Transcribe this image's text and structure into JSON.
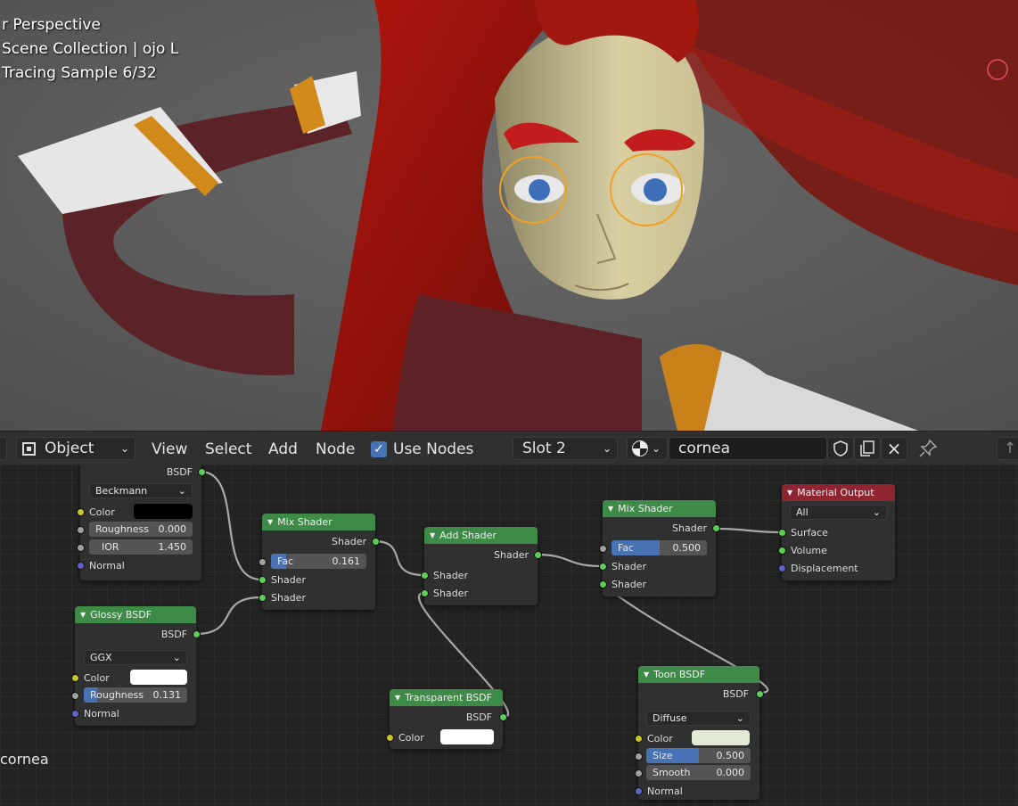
{
  "viewport": {
    "lines": [
      "r Perspective",
      "Scene Collection | ojo L",
      "Tracing Sample 6/32"
    ]
  },
  "header": {
    "mode": "Object",
    "menus": [
      "View",
      "Select",
      "Add",
      "Node"
    ],
    "use_nodes_label": "Use Nodes",
    "use_nodes_checked": true,
    "slot": "Slot 2",
    "material_name": "cornea"
  },
  "editor": {
    "material_label": "cornea",
    "nodes": {
      "glass": {
        "output": "BSDF",
        "distribution": "Beckmann",
        "color_label": "Color",
        "color_value": "#000000",
        "roughness_label": "Roughness",
        "roughness_value": "0.000",
        "ior_label": "IOR",
        "ior_value": "1.450",
        "normal_label": "Normal"
      },
      "glossy": {
        "title": "Glossy BSDF",
        "output": "BSDF",
        "distribution": "GGX",
        "color_label": "Color",
        "color_value": "#ffffff",
        "roughness_label": "Roughness",
        "roughness_value": "0.131",
        "roughness_fraction": 0.131,
        "normal_label": "Normal"
      },
      "mix1": {
        "title": "Mix Shader",
        "output": "Shader",
        "fac_label": "Fac",
        "fac_value": "0.161",
        "fac_fraction": 0.161,
        "in1": "Shader",
        "in2": "Shader"
      },
      "add": {
        "title": "Add Shader",
        "output": "Shader",
        "in1": "Shader",
        "in2": "Shader"
      },
      "transparent": {
        "title": "Transparent BSDF",
        "output": "BSDF",
        "color_label": "Color",
        "color_value": "#ffffff"
      },
      "mix2": {
        "title": "Mix Shader",
        "output": "Shader",
        "fac_label": "Fac",
        "fac_value": "0.500",
        "fac_fraction": 0.5,
        "in1": "Shader",
        "in2": "Shader"
      },
      "output": {
        "title": "Material Output",
        "target": "All",
        "surface": "Surface",
        "volume": "Volume",
        "displacement": "Displacement"
      },
      "toon": {
        "title": "Toon BSDF",
        "output": "BSDF",
        "component": "Diffuse",
        "color_label": "Color",
        "color_value": "#e2ead6",
        "size_label": "Size",
        "size_value": "0.500",
        "size_fraction": 0.5,
        "smooth_label": "Smooth",
        "smooth_value": "0.000",
        "normal_label": "Normal"
      }
    }
  }
}
